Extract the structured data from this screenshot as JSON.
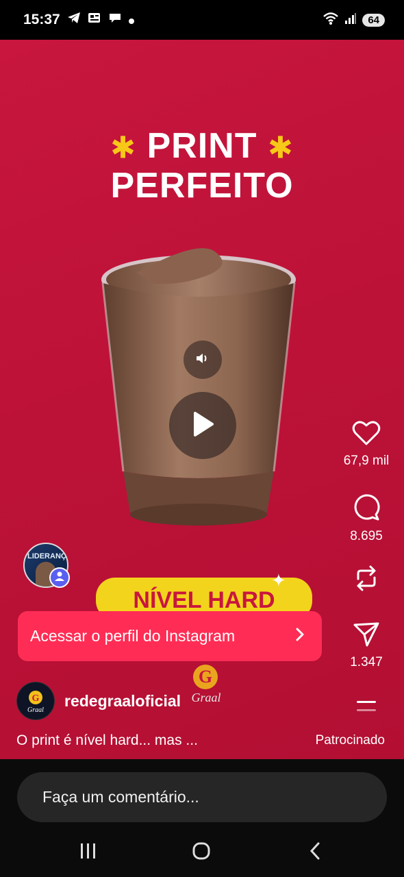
{
  "status_bar": {
    "time": "15:37",
    "battery": "64"
  },
  "post": {
    "headline_line1": "PRINT",
    "headline_line2": "PERFEITO",
    "banner_text": "NÍVEL HARD",
    "brand_watermark": "Graal"
  },
  "actions": {
    "likes": "67,9 mil",
    "comments": "8.695",
    "shares": "1.347"
  },
  "cta": {
    "label": "Acessar o perfil do Instagram"
  },
  "profile": {
    "username": "redegraaloficial",
    "logo_text": "Graal"
  },
  "caption": "O print é nível hard... mas ...",
  "sponsored_label": "Patrocinado",
  "comment_placeholder": "Faça um comentário...",
  "story_avatar_text": "LIDERANÇA",
  "colors": {
    "background": "#c8163e",
    "cta": "#ff2d55",
    "banner": "#f3d41c",
    "accent_star": "#f7c818"
  }
}
